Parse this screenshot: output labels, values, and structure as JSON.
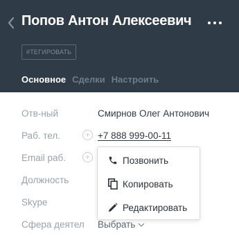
{
  "header": {
    "title": "Попов Антон Алексеевич",
    "tag_button": "#ТЕГИРОВАТЬ",
    "background": "#2f3c48",
    "back_icon": "chevron-left-icon",
    "more_icon": "more-dots-icon"
  },
  "tabs": [
    {
      "label": "Основное",
      "active": true
    },
    {
      "label": "Сделки",
      "active": false
    },
    {
      "label": "Настроить",
      "active": false
    }
  ],
  "fields": [
    {
      "label": "Отв-ный",
      "value": "Смирнов Олег Антонович"
    },
    {
      "label": "Раб. тел.",
      "value": "+7 888 999-00-11"
    },
    {
      "label": "Email раб.",
      "value": ""
    },
    {
      "label": "Должность",
      "value": ""
    },
    {
      "label": "Skype",
      "value": ""
    },
    {
      "label": "Сфера деятел",
      "value": "Выбрать"
    }
  ],
  "context_menu": {
    "items": [
      {
        "label": "Позвонить",
        "icon": "phone-icon"
      },
      {
        "label": "Копировать",
        "icon": "copy-icon"
      },
      {
        "label": "Редактировать",
        "icon": "pencil-icon"
      }
    ]
  }
}
